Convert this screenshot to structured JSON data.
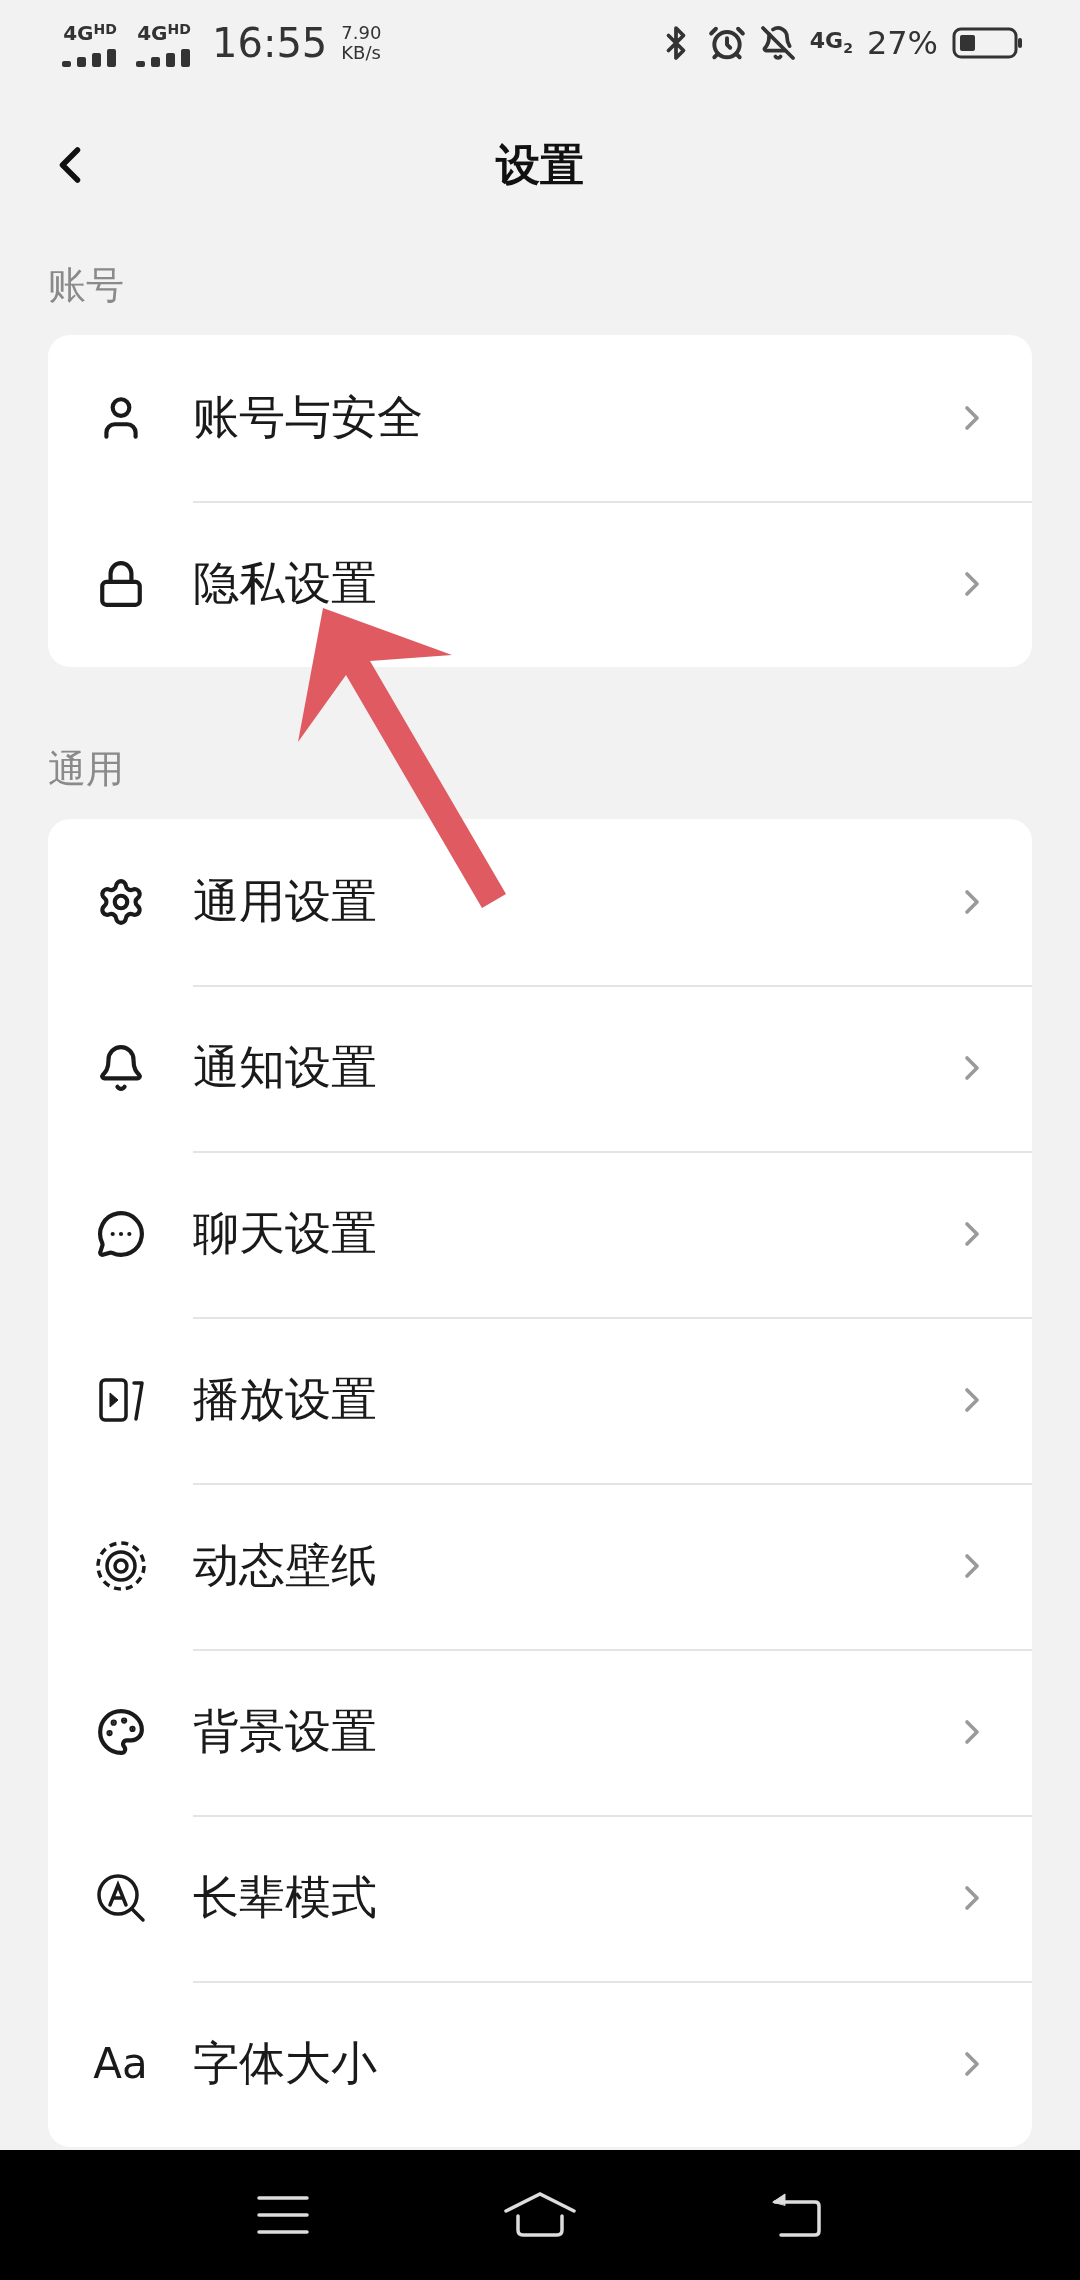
{
  "status_bar": {
    "sim_1": "4G$^{HD}$",
    "sim_2": "4G$^{HD}$",
    "time": "16:55",
    "net_speed": "7.90",
    "net_unit": "KB/s",
    "network": "4G$_{2}$",
    "battery": "27%"
  },
  "header": {
    "title": "设置"
  },
  "sections": [
    {
      "title": "账号",
      "items": [
        {
          "label": "账号与安全"
        },
        {
          "label": "隐私设置"
        }
      ]
    },
    {
      "title": "通用",
      "items": [
        {
          "label": "通用设置"
        },
        {
          "label": "通知设置"
        },
        {
          "label": "聊天设置"
        },
        {
          "label": "播放设置"
        },
        {
          "label": "动态壁纸"
        },
        {
          "label": "背景设置"
        },
        {
          "label": "长辈模式"
        },
        {
          "glyph": "Aa",
          "label": "字体大小"
        }
      ]
    }
  ]
}
